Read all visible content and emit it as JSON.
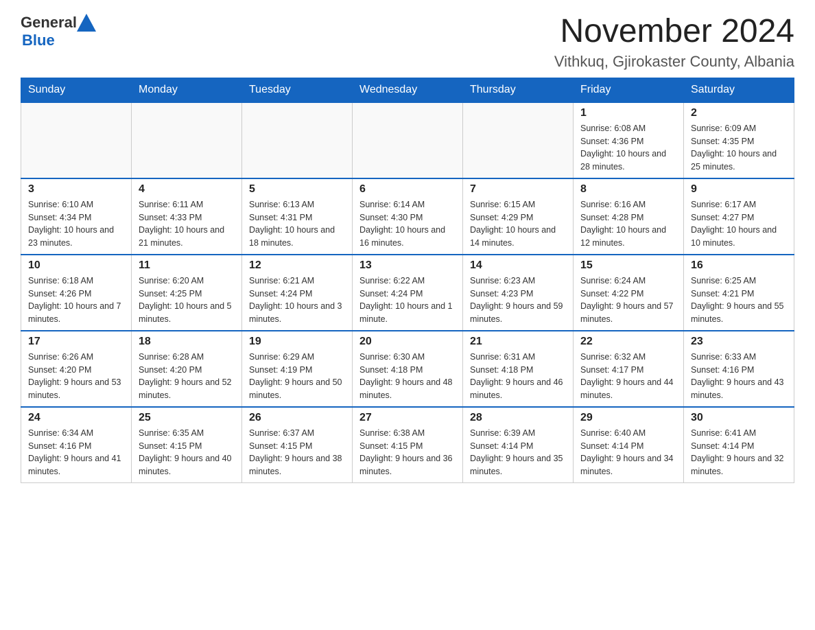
{
  "header": {
    "logo_general": "General",
    "logo_blue": "Blue",
    "main_title": "November 2024",
    "subtitle": "Vithkuq, Gjirokaster County, Albania"
  },
  "weekdays": [
    "Sunday",
    "Monday",
    "Tuesday",
    "Wednesday",
    "Thursday",
    "Friday",
    "Saturday"
  ],
  "weeks": [
    [
      {
        "day": "",
        "info": ""
      },
      {
        "day": "",
        "info": ""
      },
      {
        "day": "",
        "info": ""
      },
      {
        "day": "",
        "info": ""
      },
      {
        "day": "",
        "info": ""
      },
      {
        "day": "1",
        "info": "Sunrise: 6:08 AM\nSunset: 4:36 PM\nDaylight: 10 hours and 28 minutes."
      },
      {
        "day": "2",
        "info": "Sunrise: 6:09 AM\nSunset: 4:35 PM\nDaylight: 10 hours and 25 minutes."
      }
    ],
    [
      {
        "day": "3",
        "info": "Sunrise: 6:10 AM\nSunset: 4:34 PM\nDaylight: 10 hours and 23 minutes."
      },
      {
        "day": "4",
        "info": "Sunrise: 6:11 AM\nSunset: 4:33 PM\nDaylight: 10 hours and 21 minutes."
      },
      {
        "day": "5",
        "info": "Sunrise: 6:13 AM\nSunset: 4:31 PM\nDaylight: 10 hours and 18 minutes."
      },
      {
        "day": "6",
        "info": "Sunrise: 6:14 AM\nSunset: 4:30 PM\nDaylight: 10 hours and 16 minutes."
      },
      {
        "day": "7",
        "info": "Sunrise: 6:15 AM\nSunset: 4:29 PM\nDaylight: 10 hours and 14 minutes."
      },
      {
        "day": "8",
        "info": "Sunrise: 6:16 AM\nSunset: 4:28 PM\nDaylight: 10 hours and 12 minutes."
      },
      {
        "day": "9",
        "info": "Sunrise: 6:17 AM\nSunset: 4:27 PM\nDaylight: 10 hours and 10 minutes."
      }
    ],
    [
      {
        "day": "10",
        "info": "Sunrise: 6:18 AM\nSunset: 4:26 PM\nDaylight: 10 hours and 7 minutes."
      },
      {
        "day": "11",
        "info": "Sunrise: 6:20 AM\nSunset: 4:25 PM\nDaylight: 10 hours and 5 minutes."
      },
      {
        "day": "12",
        "info": "Sunrise: 6:21 AM\nSunset: 4:24 PM\nDaylight: 10 hours and 3 minutes."
      },
      {
        "day": "13",
        "info": "Sunrise: 6:22 AM\nSunset: 4:24 PM\nDaylight: 10 hours and 1 minute."
      },
      {
        "day": "14",
        "info": "Sunrise: 6:23 AM\nSunset: 4:23 PM\nDaylight: 9 hours and 59 minutes."
      },
      {
        "day": "15",
        "info": "Sunrise: 6:24 AM\nSunset: 4:22 PM\nDaylight: 9 hours and 57 minutes."
      },
      {
        "day": "16",
        "info": "Sunrise: 6:25 AM\nSunset: 4:21 PM\nDaylight: 9 hours and 55 minutes."
      }
    ],
    [
      {
        "day": "17",
        "info": "Sunrise: 6:26 AM\nSunset: 4:20 PM\nDaylight: 9 hours and 53 minutes."
      },
      {
        "day": "18",
        "info": "Sunrise: 6:28 AM\nSunset: 4:20 PM\nDaylight: 9 hours and 52 minutes."
      },
      {
        "day": "19",
        "info": "Sunrise: 6:29 AM\nSunset: 4:19 PM\nDaylight: 9 hours and 50 minutes."
      },
      {
        "day": "20",
        "info": "Sunrise: 6:30 AM\nSunset: 4:18 PM\nDaylight: 9 hours and 48 minutes."
      },
      {
        "day": "21",
        "info": "Sunrise: 6:31 AM\nSunset: 4:18 PM\nDaylight: 9 hours and 46 minutes."
      },
      {
        "day": "22",
        "info": "Sunrise: 6:32 AM\nSunset: 4:17 PM\nDaylight: 9 hours and 44 minutes."
      },
      {
        "day": "23",
        "info": "Sunrise: 6:33 AM\nSunset: 4:16 PM\nDaylight: 9 hours and 43 minutes."
      }
    ],
    [
      {
        "day": "24",
        "info": "Sunrise: 6:34 AM\nSunset: 4:16 PM\nDaylight: 9 hours and 41 minutes."
      },
      {
        "day": "25",
        "info": "Sunrise: 6:35 AM\nSunset: 4:15 PM\nDaylight: 9 hours and 40 minutes."
      },
      {
        "day": "26",
        "info": "Sunrise: 6:37 AM\nSunset: 4:15 PM\nDaylight: 9 hours and 38 minutes."
      },
      {
        "day": "27",
        "info": "Sunrise: 6:38 AM\nSunset: 4:15 PM\nDaylight: 9 hours and 36 minutes."
      },
      {
        "day": "28",
        "info": "Sunrise: 6:39 AM\nSunset: 4:14 PM\nDaylight: 9 hours and 35 minutes."
      },
      {
        "day": "29",
        "info": "Sunrise: 6:40 AM\nSunset: 4:14 PM\nDaylight: 9 hours and 34 minutes."
      },
      {
        "day": "30",
        "info": "Sunrise: 6:41 AM\nSunset: 4:14 PM\nDaylight: 9 hours and 32 minutes."
      }
    ]
  ]
}
